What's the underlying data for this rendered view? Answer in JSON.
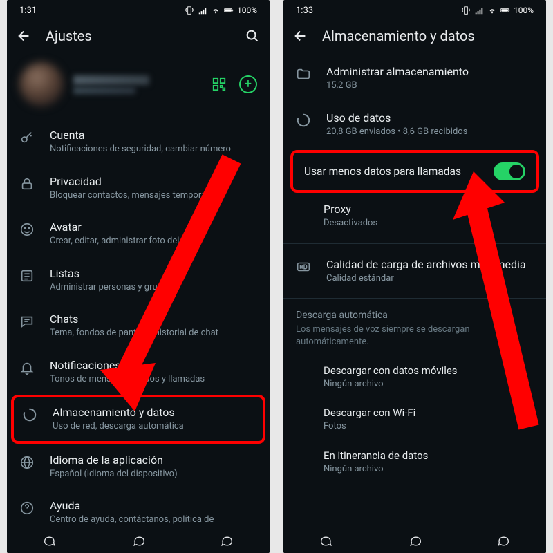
{
  "left": {
    "time": "1:31",
    "battery": "100%",
    "header_title": "Ajustes",
    "settings": [
      {
        "icon": "key",
        "title": "Cuenta",
        "sub": "Notificaciones de seguridad, cambiar número"
      },
      {
        "icon": "lock",
        "title": "Privacidad",
        "sub": "Bloquear contactos, mensajes temporales"
      },
      {
        "icon": "face",
        "title": "Avatar",
        "sub": "Crear, editar, administrar foto del perfil"
      },
      {
        "icon": "list",
        "title": "Listas",
        "sub": "Administrar personas y grupos"
      },
      {
        "icon": "chat",
        "title": "Chats",
        "sub": "Tema, fondos de pantalla, historial de chat"
      },
      {
        "icon": "bell",
        "title": "Notificaciones",
        "sub": "Tonos de mensajes, grupos y llamadas"
      },
      {
        "icon": "data",
        "title": "Almacenamiento y datos",
        "sub": "Uso de red, descarga automática"
      },
      {
        "icon": "globe",
        "title": "Idioma de la aplicación",
        "sub": "Español (idioma del dispositivo)"
      },
      {
        "icon": "help",
        "title": "Ayuda",
        "sub": "Centro de ayuda, contáctanos, política de"
      }
    ]
  },
  "right": {
    "time": "1:33",
    "battery": "100%",
    "header_title": "Almacenamiento y datos",
    "items": [
      {
        "icon": "folder",
        "title": "Administrar almacenamiento",
        "sub": "15,2 GB"
      },
      {
        "icon": "data",
        "title": "Uso de datos",
        "sub": "20,8 GB enviados • 8,6 GB recibidos"
      }
    ],
    "toggle_label": "Usar menos datos para llamadas",
    "proxy_title": "Proxy",
    "proxy_sub": "Desactivados",
    "quality_title": "Calidad de carga de archivos multimedia",
    "quality_sub": "Calidad estándar",
    "section_label": "Descarga automática",
    "section_desc": "Los mensajes de voz siempre se descargan automáticamente.",
    "download_items": [
      {
        "title": "Descargar con datos móviles",
        "sub": "Ningún archivo"
      },
      {
        "title": "Descargar con Wi-Fi",
        "sub": "Fotos"
      },
      {
        "title": "En itinerancia de datos",
        "sub": "Ningún archivo"
      }
    ]
  }
}
